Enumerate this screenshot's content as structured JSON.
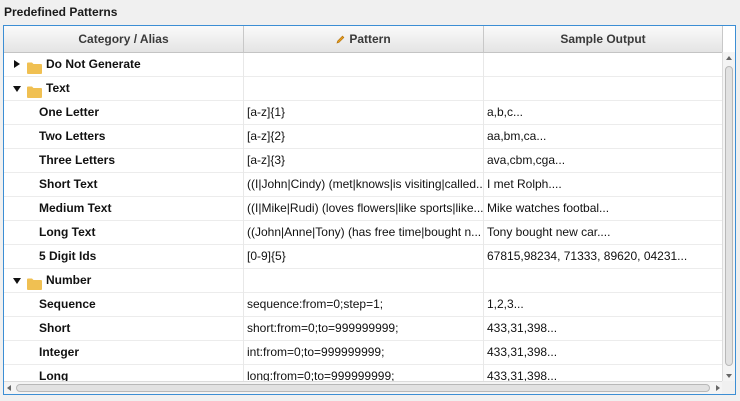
{
  "panel": {
    "title": "Predefined Patterns"
  },
  "columns": {
    "category": "Category / Alias",
    "pattern": "Pattern",
    "sample": "Sample Output"
  },
  "icons": {
    "folder": "folder-icon",
    "pencil": "pencil-icon",
    "folder_color": "#f0c052",
    "pencil_color": "#e39b1e"
  },
  "rows": [
    {
      "type": "group",
      "expanded": false,
      "label": "Do Not Generate",
      "pattern": "",
      "sample": ""
    },
    {
      "type": "group",
      "expanded": true,
      "label": "Text",
      "pattern": "",
      "sample": ""
    },
    {
      "type": "leaf",
      "label": "One Letter",
      "pattern": "[a-z]{1}",
      "sample": "a,b,c..."
    },
    {
      "type": "leaf",
      "label": "Two Letters",
      "pattern": "[a-z]{2}",
      "sample": "aa,bm,ca..."
    },
    {
      "type": "leaf",
      "label": "Three Letters",
      "pattern": "[a-z]{3}",
      "sample": "ava,cbm,cga..."
    },
    {
      "type": "leaf",
      "label": "Short Text",
      "pattern": "((I|John|Cindy) (met|knows|is visiting|called...",
      "sample": "I met Rolph...."
    },
    {
      "type": "leaf",
      "label": "Medium Text",
      "pattern": "((I|Mike|Rudi) (loves flowers|like sports|like...",
      "sample": "Mike watches footbal..."
    },
    {
      "type": "leaf",
      "label": "Long Text",
      "pattern": "((John|Anne|Tony) (has free time|bought n...",
      "sample": "Tony bought new car...."
    },
    {
      "type": "leaf",
      "label": "5 Digit Ids",
      "pattern": "[0-9]{5}",
      "sample": "67815,98234, 71333, 89620, 04231..."
    },
    {
      "type": "group",
      "expanded": true,
      "label": "Number",
      "pattern": "",
      "sample": ""
    },
    {
      "type": "leaf",
      "label": "Sequence",
      "pattern": "sequence:from=0;step=1;",
      "sample": "1,2,3..."
    },
    {
      "type": "leaf",
      "label": "Short",
      "pattern": "short:from=0;to=999999999;",
      "sample": "433,31,398..."
    },
    {
      "type": "leaf",
      "label": "Integer",
      "pattern": "int:from=0;to=999999999;",
      "sample": "433,31,398..."
    },
    {
      "type": "leaf",
      "label": "Long",
      "pattern": "long:from=0;to=999999999;",
      "sample": "433,31,398..."
    }
  ]
}
